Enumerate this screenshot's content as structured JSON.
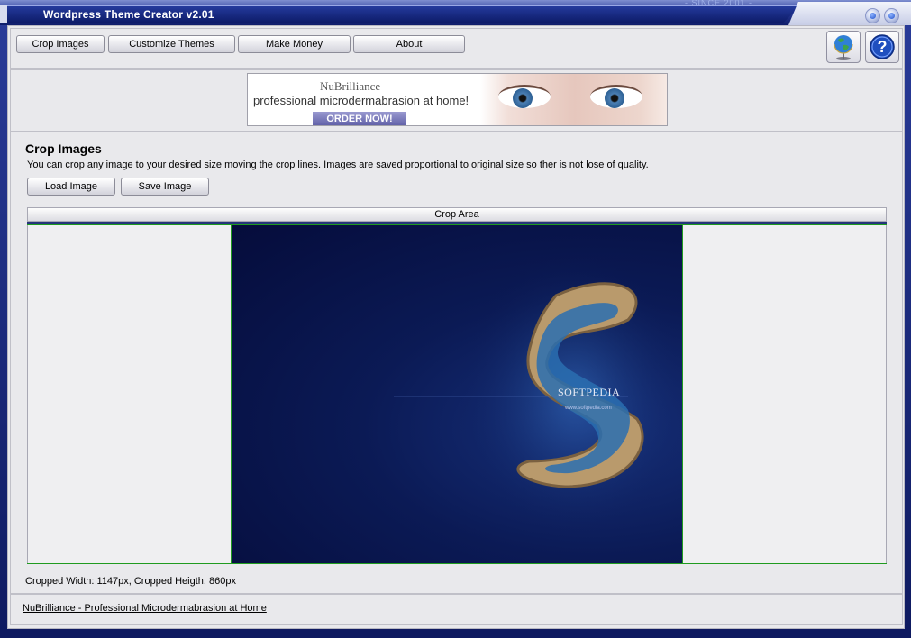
{
  "window": {
    "title": "Wordpress Theme Creator v2.01",
    "since_text": "- SINCE 2001 -",
    "accent_color": "#1f3596"
  },
  "toolbar": {
    "buttons": [
      {
        "label": "Crop Images"
      },
      {
        "label": "Customize Themes"
      },
      {
        "label": "Make Money"
      },
      {
        "label": "About"
      }
    ],
    "icons": [
      "globe-icon",
      "help-icon"
    ]
  },
  "ad": {
    "brand": "NuBrilliance",
    "tagline": "professional microdermabrasion at home!",
    "cta": "ORDER NOW!"
  },
  "crop": {
    "heading": "Crop Images",
    "description": "You can crop any image to your desired size moving the crop lines. Images are saved proportional to original size so ther is not lose of quality.",
    "load_label": "Load Image",
    "save_label": "Save Image",
    "area_label": "Crop Area",
    "status": "Cropped Width: 1147px, Cropped Heigth: 860px",
    "image_text": "SOFTPEDIA",
    "image_url": "www.softpedia.com"
  },
  "footer": {
    "link": "NuBrilliance - Professional Microdermabrasion at Home"
  }
}
